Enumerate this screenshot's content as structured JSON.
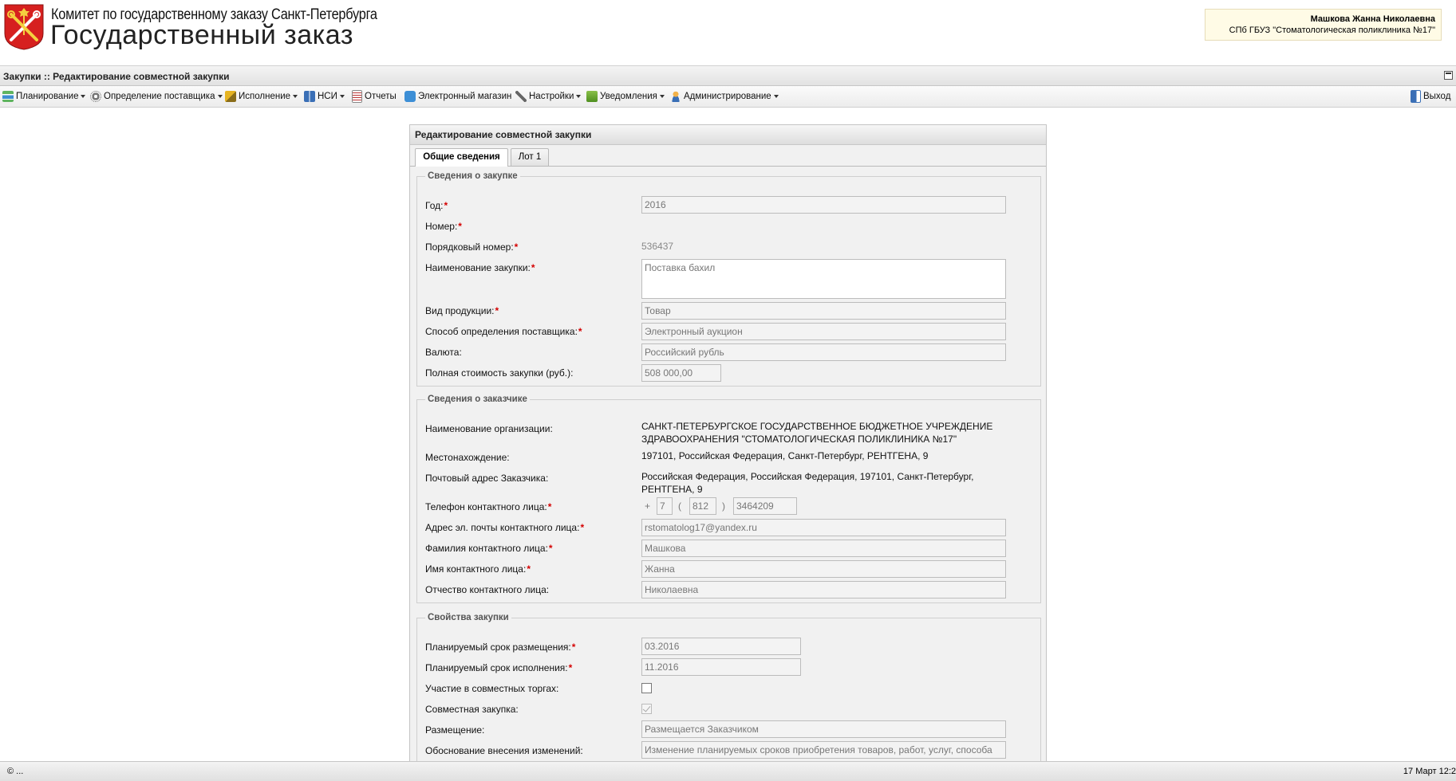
{
  "header": {
    "org_line": "Комитет по государственному заказу Санкт-Петербурга",
    "app_title": "Государственный заказ",
    "user_name": "Машкова Жанна Николаевна",
    "user_org": "СПб ГБУЗ \"Стоматологическая поликлиника №17\""
  },
  "breadcrumb": "Закупки :: Редактирование совместной закупки",
  "toolbar": {
    "items": [
      {
        "label": "Планирование",
        "icon": "planning-icon",
        "dropdown": true
      },
      {
        "label": "Определение поставщика",
        "icon": "gear-icon",
        "dropdown": true
      },
      {
        "label": "Исполнение",
        "icon": "execution-icon",
        "dropdown": true
      },
      {
        "label": "НСИ",
        "icon": "book-icon",
        "dropdown": true
      },
      {
        "label": "Отчеты",
        "icon": "report-icon",
        "dropdown": false
      },
      {
        "label": "Электронный магазин",
        "icon": "cart-icon",
        "dropdown": false
      },
      {
        "label": "Настройки",
        "icon": "wrench-icon",
        "dropdown": true
      },
      {
        "label": "Уведомления",
        "icon": "notification-icon",
        "dropdown": true
      },
      {
        "label": "Администрирование",
        "icon": "user-icon",
        "dropdown": true
      }
    ],
    "logout": "Выход"
  },
  "panel": {
    "title": "Редактирование совместной закупки",
    "tabs": [
      "Общие сведения",
      "Лот 1"
    ]
  },
  "purchase": {
    "legend": "Сведения о закупке",
    "year_label": "Год:",
    "year": "2016",
    "number_label": "Номер:",
    "seq_label": "Порядковый номер:",
    "seq": "536437",
    "name_label": "Наименование закупки:",
    "name": "Поставка бахил",
    "product_label": "Вид продукции:",
    "product": "Товар",
    "method_label": "Способ определения поставщика:",
    "method": "Электронный аукцион",
    "currency_label": "Валюта:",
    "currency": "Российский рубль",
    "cost_label": "Полная стоимость закупки (руб.):",
    "cost": "508 000,00"
  },
  "customer": {
    "legend": "Сведения о заказчике",
    "org_label": "Наименование организации:",
    "org_line1": "САНКТ-ПЕТЕРБУРГСКОЕ ГОСУДАРСТВЕННОЕ БЮДЖЕТНОЕ УЧРЕЖДЕНИЕ",
    "org_line2": "ЗДРАВООХРАНЕНИЯ \"СТОМАТОЛОГИЧЕСКАЯ ПОЛИКЛИНИКА №17\"",
    "location_label": "Местонахождение:",
    "location": "197101, Российская Федерация, Санкт-Петербург, РЕНТГЕНА, 9",
    "postal_label": "Почтовый адрес Заказчика:",
    "postal_line1": "Российская Федерация, Российская Федерация, 197101, Санкт-Петербург,",
    "postal_line2": "РЕНТГЕНА, 9",
    "phone_label": "Телефон контактного лица:",
    "phone_plus": "+",
    "phone_country": "7",
    "phone_open": "(",
    "phone_code": "812",
    "phone_close": ")",
    "phone_number": "3464209",
    "email_label": "Адрес эл. почты контактного лица:",
    "email": "rstomatolog17@yandex.ru",
    "lastname_label": "Фамилия контактного лица:",
    "lastname": "Машкова",
    "firstname_label": "Имя контактного лица:",
    "firstname": "Жанна",
    "patronymic_label": "Отчество контактного лица:",
    "patronymic": "Николаевна"
  },
  "properties": {
    "legend": "Свойства закупки",
    "placement_date_label": "Планируемый срок размещения:",
    "placement_date": "03.2016",
    "execution_date_label": "Планируемый срок исполнения:",
    "execution_date": "11.2016",
    "joint_trading_label": "Участие в совместных торгах:",
    "joint_trading": false,
    "joint_purchase_label": "Совместная закупка:",
    "joint_purchase": true,
    "placement_label": "Размещение:",
    "placement": "Размещается Заказчиком",
    "reason_label": "Обоснование внесения изменений:",
    "reason": "Изменение планируемых сроков приобретения товаров, работ, услуг, способа"
  },
  "statusbar": {
    "left": "© ...",
    "right": "17 Март 12:2"
  },
  "colors": {
    "required": "#d40000",
    "user_box_bg": "#fffbe6",
    "logo_red": "#d6201f"
  }
}
